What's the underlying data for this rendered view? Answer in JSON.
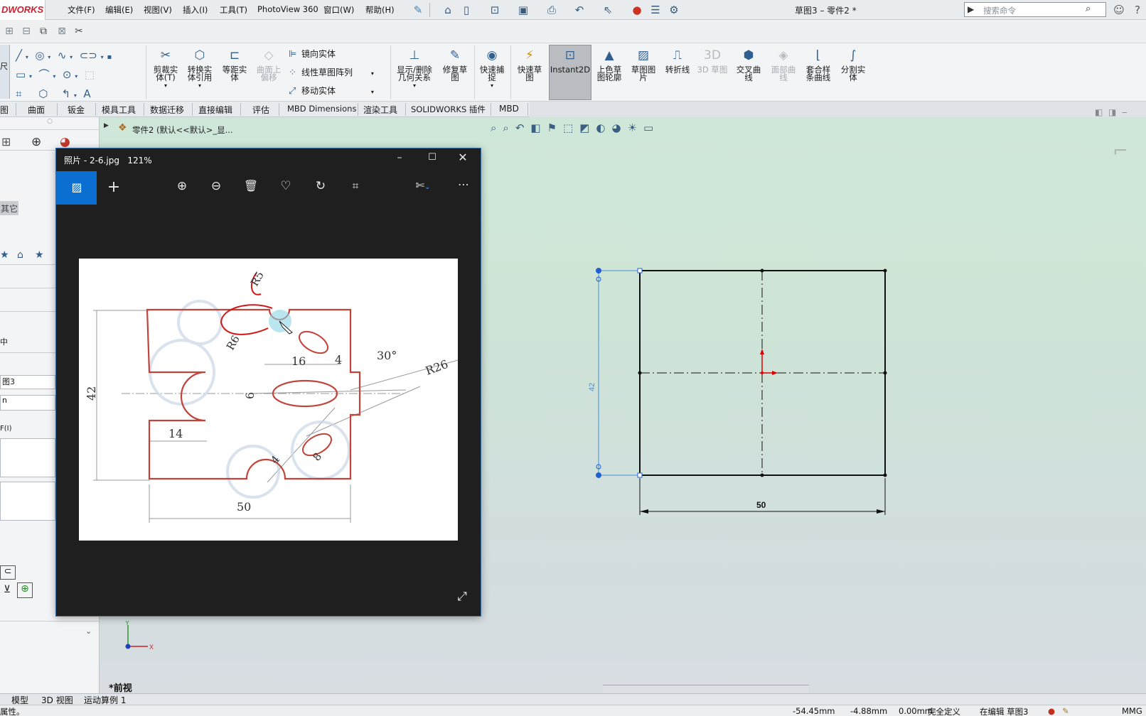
{
  "app": {
    "logo": "DWORKS",
    "menus": [
      "文件(F)",
      "编辑(E)",
      "视图(V)",
      "插入(I)",
      "工具(T)",
      "PhotoView 360",
      "窗口(W)",
      "帮助(H)"
    ],
    "doc_title": "草图3 – 零件2 *",
    "search_placeholder": "搜索命令"
  },
  "toolbar": {
    "left_truncated": "尺",
    "large_tools": [
      {
        "label": "剪裁实\n体(T)",
        "icon": "trim-icon"
      },
      {
        "label": "转换实\n体引用",
        "icon": "convert-icon"
      },
      {
        "label": "等距实\n体",
        "icon": "offset-icon"
      },
      {
        "label": "曲面上\n偏移",
        "icon": "surface-offset-icon",
        "disabled": true
      }
    ],
    "row_tools": [
      "镜向实体",
      "线性草图阵列",
      "移动实体"
    ],
    "large_tools2": [
      {
        "label": "显示/删除\n几何关系",
        "icon": "relations-icon"
      },
      {
        "label": "修复草\n图",
        "icon": "repair-icon"
      },
      {
        "label": "快速捕\n捉",
        "icon": "snap-icon"
      },
      {
        "label": "快速草\n图",
        "icon": "rapid-sketch-icon"
      },
      {
        "label": "Instant2D",
        "icon": "instant2d-icon"
      },
      {
        "label": "上色草\n图轮廓",
        "icon": "shaded-sketch-icon"
      },
      {
        "label": "草图图\n片",
        "icon": "sketch-picture-icon"
      },
      {
        "label": "转折线",
        "icon": "jog-line-icon"
      },
      {
        "label": "3D 草图",
        "icon": "3d-sketch-icon",
        "disabled": true
      },
      {
        "label": "交叉曲\n线",
        "icon": "intersection-curve-icon"
      },
      {
        "label": "面部曲\n线",
        "icon": "face-curve-icon",
        "disabled": true
      },
      {
        "label": "套合样\n条曲线",
        "icon": "fit-spline-icon"
      },
      {
        "label": "分割实\n体",
        "icon": "split-entity-icon"
      }
    ]
  },
  "tabs": [
    "图",
    "曲面",
    "钣金",
    "模具工具",
    "数据迁移",
    "直接编辑",
    "评估",
    "MBD Dimensions",
    "渲染工具",
    "SOLIDWORKS 插件",
    "MBD"
  ],
  "left_panel": {
    "other_label": "其它",
    "fields": [
      "中",
      "图3",
      "n",
      "F(I)"
    ]
  },
  "breadcrumb": "零件2 (默认<<默认>_显...",
  "viewport": {
    "view_name": "*前视",
    "sketch": {
      "dim_width": "50",
      "dim_height": "42"
    }
  },
  "bottom_tabs": [
    "模型",
    "3D 视图",
    "运动算例 1"
  ],
  "status": {
    "left": "属性。",
    "x": "-54.45mm",
    "y": "-4.88mm",
    "z": "0.00mm",
    "state": "完全定义",
    "editing": "在编辑 草图3",
    "units": "MMG"
  },
  "photos": {
    "title": "照片 - 2-6.jpg",
    "zoom": "121%",
    "drawing_labels": {
      "r5": "R5",
      "r6": "R6",
      "d16": "16",
      "d4": "4",
      "a30": "30°",
      "r26": "R26",
      "d6": "6",
      "d42": "42",
      "d14": "14",
      "d4b": "4",
      "d8": "8",
      "d50": "50"
    }
  }
}
